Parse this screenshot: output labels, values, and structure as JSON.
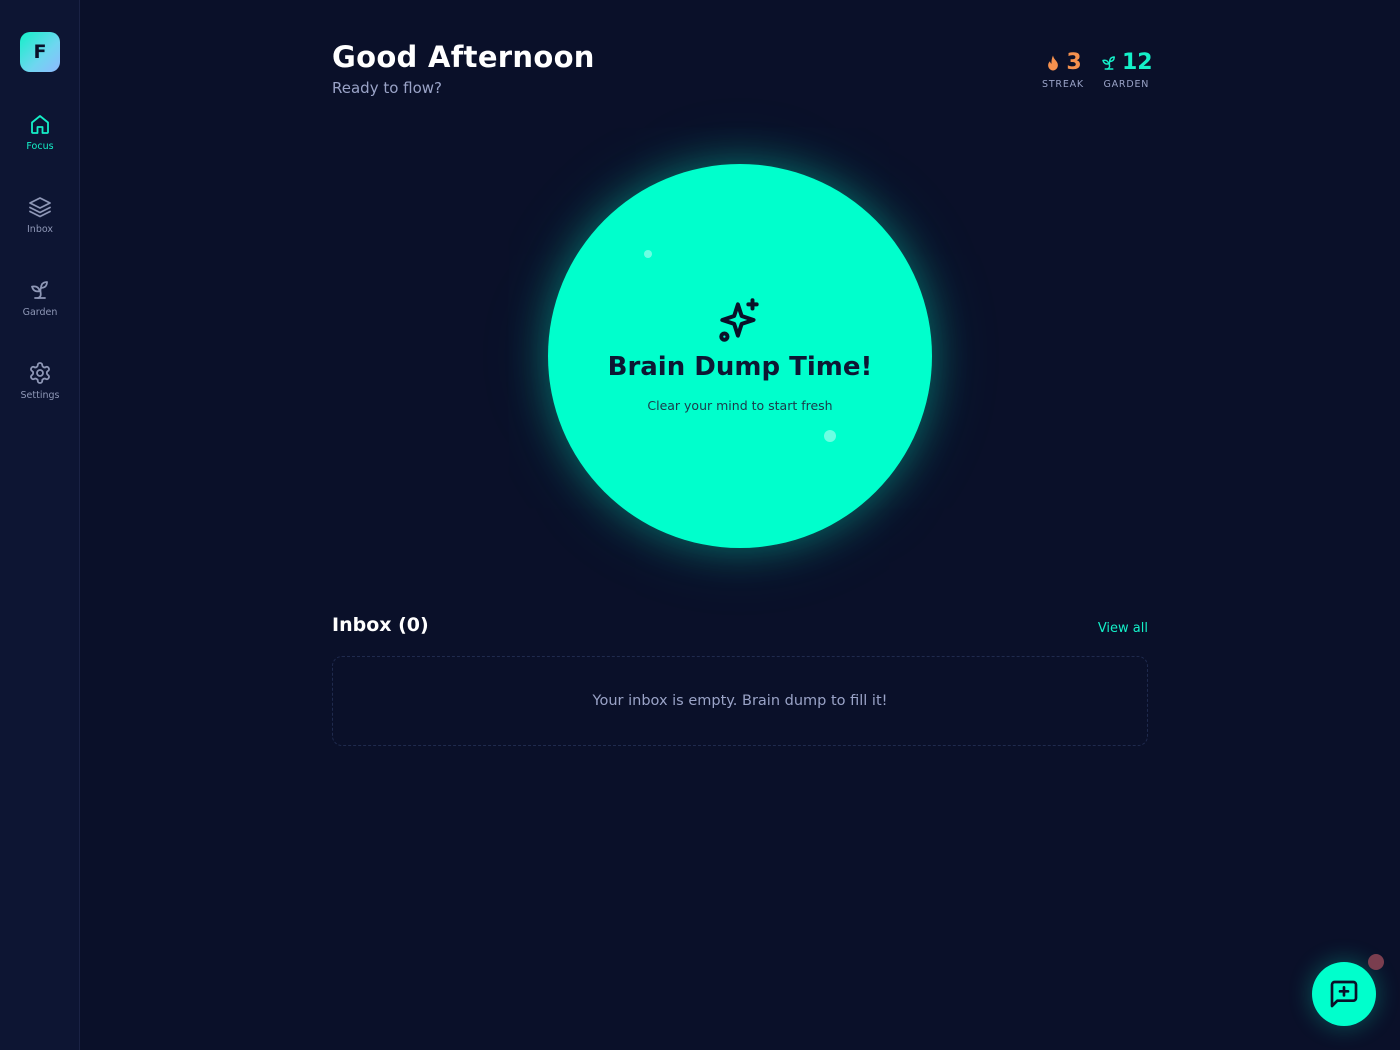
{
  "sidebar": {
    "logo_letter": "F",
    "items": [
      {
        "label": "Focus",
        "icon": "home-icon",
        "active": true
      },
      {
        "label": "Inbox",
        "icon": "layers-icon",
        "active": false
      },
      {
        "label": "Garden",
        "icon": "sprout-icon",
        "active": false
      },
      {
        "label": "Settings",
        "icon": "gear-icon",
        "active": false
      }
    ]
  },
  "header": {
    "greeting": "Good Afternoon",
    "subtitle": "Ready to flow?"
  },
  "stats": {
    "streak": {
      "value": "3",
      "label": "STREAK",
      "icon": "flame-icon",
      "color": "#f5914e"
    },
    "garden": {
      "value": "12",
      "label": "GARDEN",
      "icon": "sprout-icon",
      "color": "#14f0c8"
    }
  },
  "brain_dump": {
    "title": "Brain Dump Time!",
    "subtitle": "Clear your mind to start fresh",
    "icon": "sparkles-icon",
    "color": "#00ffcc"
  },
  "inbox": {
    "title": "Inbox (0)",
    "view_all": "View all",
    "empty_text": "Your inbox is empty. Brain dump to fill it!"
  },
  "fab": {
    "icon": "message-plus-icon"
  },
  "colors": {
    "background": "#0a1029",
    "sidebar": "#0d1533",
    "accent": "#14f0c8"
  }
}
